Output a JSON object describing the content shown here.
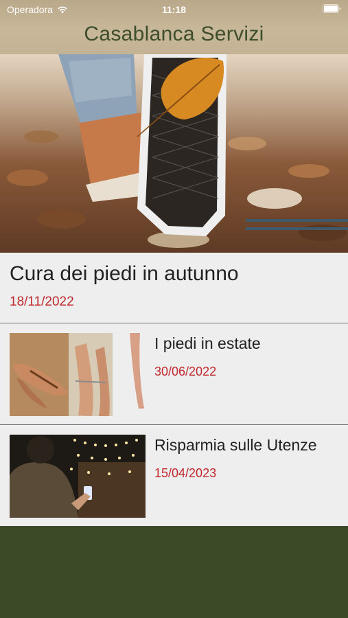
{
  "status_bar": {
    "carrier": "Operadora",
    "time": "11:18"
  },
  "header": {
    "title": "Casablanca Servizi"
  },
  "featured": {
    "title": "Cura dei piedi in autunno",
    "date": "18/11/2022",
    "image": "autumn-sneaker-photo"
  },
  "articles": [
    {
      "title": "I piedi in estate",
      "date": "30/06/2022",
      "image": "summer-sandals-photo"
    },
    {
      "title": "Risparmia sulle Utenze",
      "date": "15/04/2023",
      "image": "string-lights-person-phone-photo"
    }
  ],
  "colors": {
    "header": "#c3b293",
    "title_text": "#3e4d2b",
    "date_text": "#c0282d",
    "background": "#3d4a28",
    "card": "#eeeeee"
  }
}
